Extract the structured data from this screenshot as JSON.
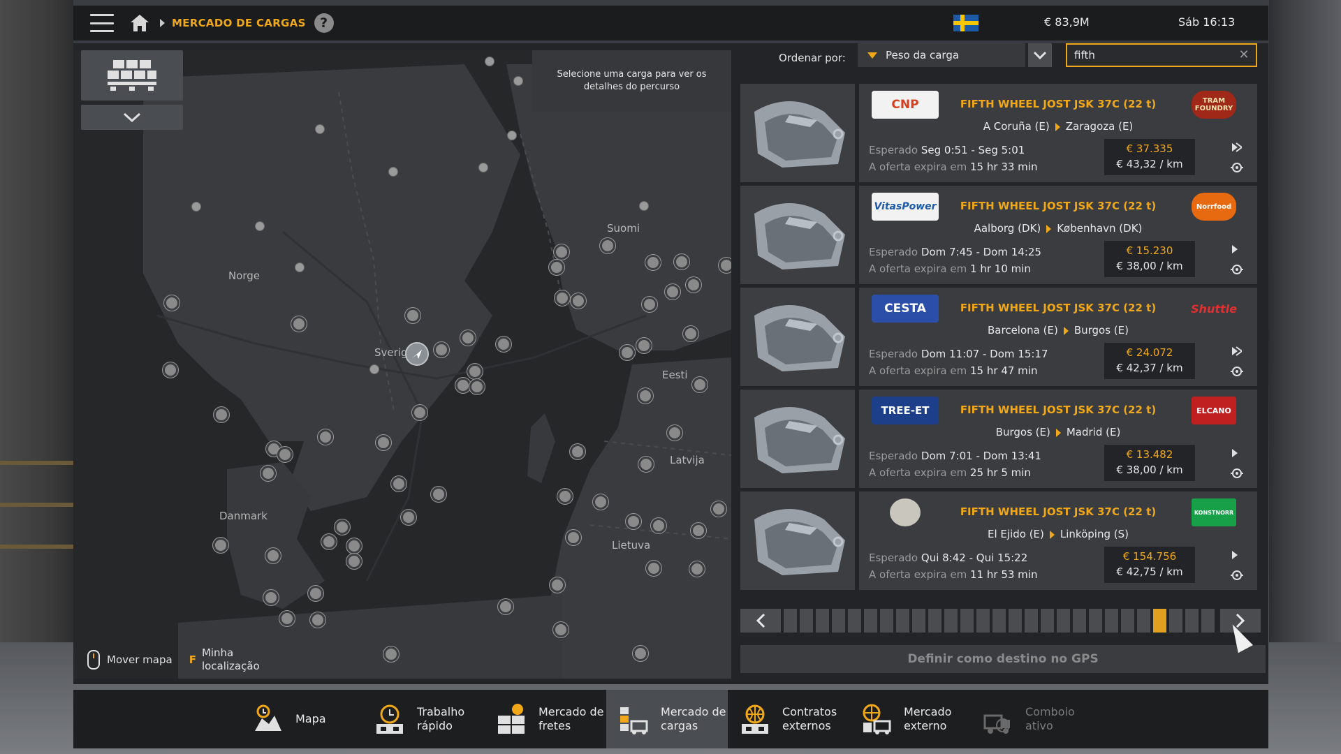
{
  "topbar": {
    "breadcrumb": "MERCADO DE CARGAS",
    "help_icon": "?",
    "money": "€ 83,9M",
    "clock": "Sáb 16:13"
  },
  "map": {
    "hint": "Selecione uma carga para ver os detalhes do percurso",
    "labels": {
      "norge": "Norge",
      "sverige": "Sverige",
      "suomi": "Suomi",
      "eesti": "Eesti",
      "latvija": "Latvija",
      "lietuva": "Lietuva",
      "danmark": "Danmark"
    },
    "footer": {
      "move": "Mover mapa",
      "key": "F",
      "locate": "Minha\nlocalização"
    }
  },
  "sort": {
    "label": "Ordenar por:",
    "value": "Peso da carga"
  },
  "search": {
    "value": "fifth",
    "clear": "✕"
  },
  "offers": [
    {
      "cargo": "FIFTH WHEEL JOST JSK 37C (22 t)",
      "from": "A Coruña (E)",
      "to": "Zaragoza (E)",
      "expected_label": "Esperado",
      "expected": "Seg 0:51 - Seg 5:01",
      "expires_label": "A oferta expira em",
      "expires": "15 hr 33 min",
      "pay": "€ 37.335",
      "per_km": "€ 43,32 / km",
      "logo_left": "CNP",
      "logo_right": "TRAM FOUNDRY"
    },
    {
      "cargo": "FIFTH WHEEL JOST JSK 37C (22 t)",
      "from": "Aalborg (DK)",
      "to": "København (DK)",
      "expected_label": "Esperado",
      "expected": "Dom 7:45 - Dom 14:25",
      "expires_label": "A oferta expira em",
      "expires": "1 hr 10 min",
      "pay": "€ 15.230",
      "per_km": "€ 38,00 / km",
      "logo_left": "VitasPower",
      "logo_right": "Norrfood"
    },
    {
      "cargo": "FIFTH WHEEL JOST JSK 37C (22 t)",
      "from": "Barcelona (E)",
      "to": "Burgos (E)",
      "expected_label": "Esperado",
      "expected": "Dom 11:07 - Dom 15:17",
      "expires_label": "A oferta expira em",
      "expires": "15 hr 47 min",
      "pay": "€ 24.072",
      "per_km": "€ 42,37 / km",
      "logo_left": "CESTA",
      "logo_right": "Shuttle"
    },
    {
      "cargo": "FIFTH WHEEL JOST JSK 37C (22 t)",
      "from": "Burgos (E)",
      "to": "Madrid (E)",
      "expected_label": "Esperado",
      "expected": "Dom 7:01 - Dom 13:41",
      "expires_label": "A oferta expira em",
      "expires": "25 hr 5 min",
      "pay": "€ 13.482",
      "per_km": "€ 38,00 / km",
      "logo_left": "TREE-ET",
      "logo_right": "ELCANO"
    },
    {
      "cargo": "FIFTH WHEEL JOST JSK 37C (22 t)",
      "from": "El Ejido (E)",
      "to": "Linköping (S)",
      "expected_label": "Esperado",
      "expected": "Qui 8:42 - Qui 15:22",
      "expires_label": "A oferta expira em",
      "expires": "11 hr 53 min",
      "pay": "€ 154.756",
      "per_km": "€ 42,75 / km",
      "logo_left": "",
      "logo_right": "KONSTNORR"
    }
  ],
  "pager": {
    "total_pages": 27,
    "active_page": 24
  },
  "gps_button": "Definir como destino no GPS",
  "tabs": [
    {
      "label": "Mapa",
      "icon": "map-icon"
    },
    {
      "label": "Trabalho\nrápido",
      "icon": "stopwatch-icon"
    },
    {
      "label": "Mercado de\nfretes",
      "icon": "freight-market-icon"
    },
    {
      "label": "Mercado de\ncargas",
      "icon": "cargo-market-icon"
    },
    {
      "label": "Contratos\nexternos",
      "icon": "globe-contracts-icon"
    },
    {
      "label": "Mercado\nexterno",
      "icon": "globe-market-icon"
    },
    {
      "label": "Comboio\nativo",
      "icon": "convoy-icon"
    }
  ],
  "colors": {
    "accent": "#f0a818",
    "panel": "#232427",
    "card": "#3a3c40",
    "active_tab": "#4a4d52"
  }
}
